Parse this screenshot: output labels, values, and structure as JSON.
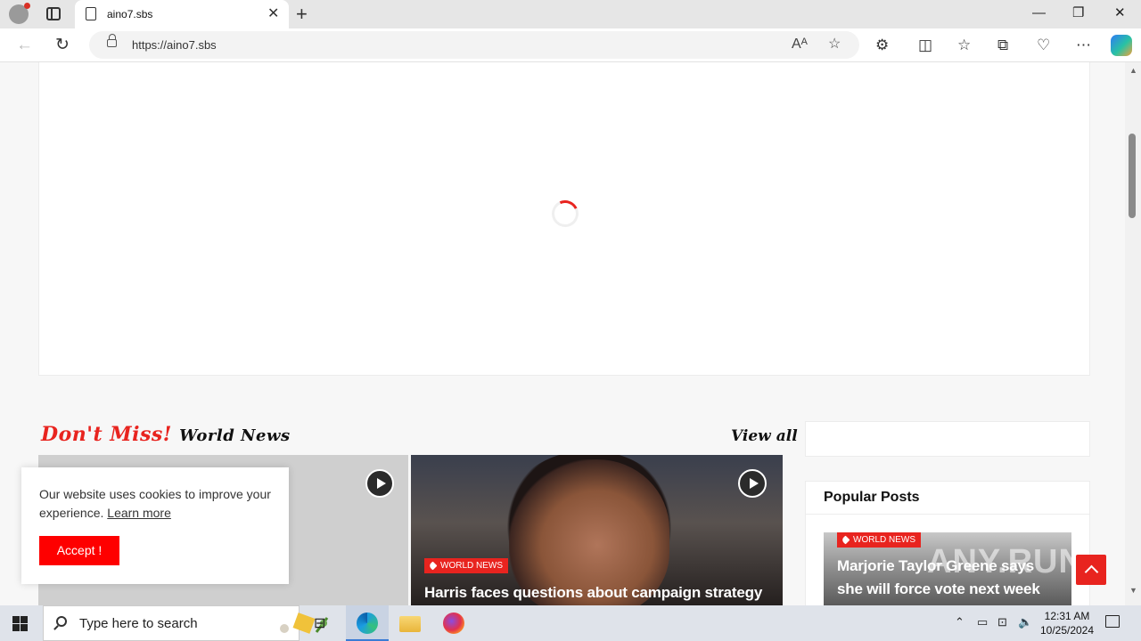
{
  "browser": {
    "tab_title": "aino7.sbs",
    "url": "https://aino7.sbs",
    "new_tab_glyph": "+",
    "close_glyph": "✕",
    "minimize_glyph": "—",
    "restore_glyph": "❐",
    "window_close_glyph": "✕"
  },
  "section": {
    "title_red": "Don't Miss!",
    "title_black": "World News",
    "view_all": "View all"
  },
  "cards": [
    {
      "badge": "",
      "title": ""
    },
    {
      "badge": "World News",
      "title": "Harris faces questions about campaign strategy in"
    }
  ],
  "sidebar": {
    "popular_title": "Popular Posts",
    "popular_badge": "World News",
    "popular_headline": "Marjorie Taylor Greene says she will force vote next week"
  },
  "cookie": {
    "text": "Our website uses cookies to improve your experience.",
    "link": "Learn more",
    "accept": "Accept !"
  },
  "watermark": "ANY.RUN",
  "taskbar": {
    "search_placeholder": "Type here to search",
    "time": "12:31 AM",
    "date": "10/25/2024"
  },
  "colors": {
    "accent": "#e8241f",
    "accept_button": "#fe0000"
  }
}
